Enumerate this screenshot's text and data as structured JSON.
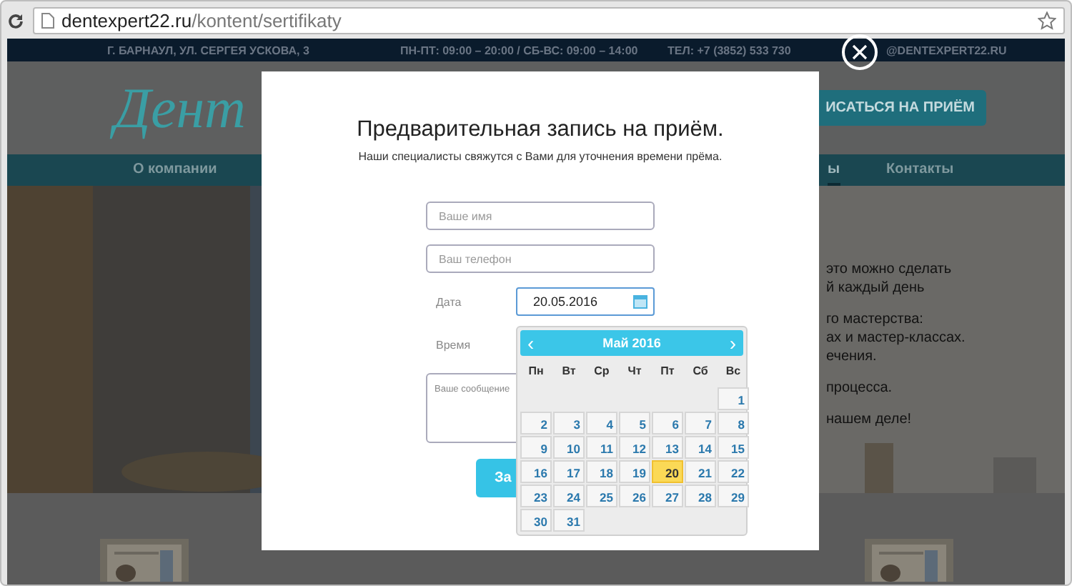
{
  "browser": {
    "url_domain": "dentexpert22.ru",
    "url_path": "/kontent/sertifikaty"
  },
  "site": {
    "top_bar": [
      "Г. БАРНАУЛ, УЛ. СЕРГЕЯ УСКОВА, 3",
      "ПН-ПТ: 09:00 – 20:00 / СБ-ВС: 09:00 – 14:00",
      "ТЕЛ: +7 (3852) 533 730",
      "@DENTEXPERT22.RU"
    ],
    "logo": "Дент",
    "cta": "ИСАТЬСЯ НА ПРИЁМ",
    "nav": [
      {
        "label": "О компании",
        "selected": false
      },
      {
        "label": "ы",
        "selected": true
      },
      {
        "label": "Контакты",
        "selected": false
      }
    ],
    "hero_text": [
      [
        "это можно сделать",
        "й каждый день"
      ],
      [
        "го мастерства:",
        "ах и мастер-классах.",
        "ечения."
      ],
      [
        "процесса."
      ],
      [
        "нашем деле!"
      ]
    ]
  },
  "modal": {
    "title": "Предварительная запись на приём.",
    "subtitle": "Наши специалисты свяжутся с Вами для уточнения времени прёма.",
    "fields": [
      {
        "kind": "input",
        "placeholder": "Ваше имя"
      },
      {
        "kind": "input",
        "placeholder": "Ваш телефон"
      },
      {
        "kind": "date",
        "label": "Дата",
        "value": "20.05.2016"
      },
      {
        "kind": "label",
        "label": "Время"
      },
      {
        "kind": "textarea",
        "placeholder": "Ваше сообщение"
      }
    ],
    "submit": "За"
  },
  "datepicker": {
    "prev": "‹",
    "month": "Май 2016",
    "next": "›",
    "weekdays": [
      "Пн",
      "Вт",
      "Ср",
      "Чт",
      "Пт",
      "Сб",
      "Вс"
    ],
    "weeks": [
      [
        {
          "day": "1",
          "selected": false
        }
      ],
      [
        {
          "day": "2",
          "selected": false
        },
        {
          "day": "3",
          "selected": false
        },
        {
          "day": "4",
          "selected": false
        },
        {
          "day": "5",
          "selected": false
        },
        {
          "day": "6",
          "selected": false
        },
        {
          "day": "7",
          "selected": false
        },
        {
          "day": "8",
          "selected": false
        }
      ],
      [
        {
          "day": "9",
          "selected": false
        },
        {
          "day": "10",
          "selected": false
        },
        {
          "day": "11",
          "selected": false
        },
        {
          "day": "12",
          "selected": false
        },
        {
          "day": "13",
          "selected": false
        },
        {
          "day": "14",
          "selected": false
        },
        {
          "day": "15",
          "selected": false
        }
      ],
      [
        {
          "day": "16",
          "selected": false
        },
        {
          "day": "17",
          "selected": false
        },
        {
          "day": "18",
          "selected": false
        },
        {
          "day": "19",
          "selected": false
        },
        {
          "day": "20",
          "selected": true
        },
        {
          "day": "21",
          "selected": false
        },
        {
          "day": "22",
          "selected": false
        }
      ],
      [
        {
          "day": "23",
          "selected": false
        },
        {
          "day": "24",
          "selected": false
        },
        {
          "day": "25",
          "selected": false
        },
        {
          "day": "26",
          "selected": false
        },
        {
          "day": "27",
          "selected": false
        },
        {
          "day": "28",
          "selected": false
        },
        {
          "day": "29",
          "selected": false
        }
      ],
      [
        {
          "day": "30",
          "selected": false
        },
        {
          "day": "31",
          "selected": false
        }
      ]
    ]
  }
}
